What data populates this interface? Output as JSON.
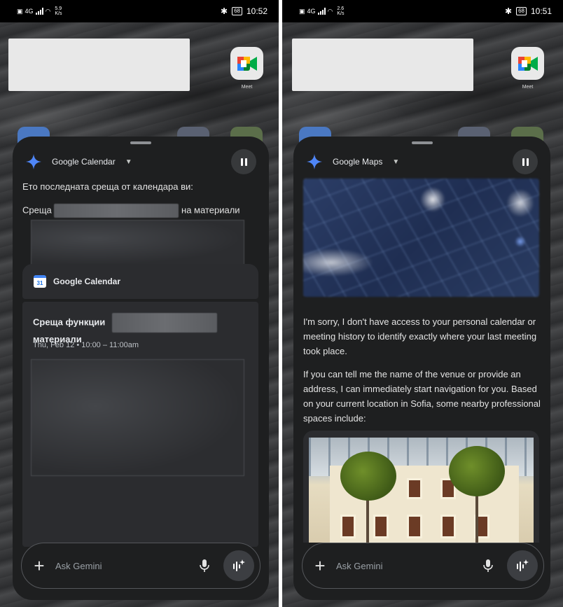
{
  "left_screen": {
    "status": {
      "speed": "5.9",
      "speed_unit": "K/s",
      "battery": "68",
      "time": "10:52",
      "network": "4G"
    },
    "home": {
      "meet_label": "Meet"
    },
    "assistant": {
      "app_name": "Google Calendar",
      "intro": "Ето последната среща от календара ви:",
      "meeting_prefix": "Среща",
      "meeting_suffix": "на материали",
      "card_title": "Google Calendar",
      "calendar_icon_text": "31",
      "event_title_start": "Среща функции",
      "event_title_end": "материали",
      "event_time": "Thu, Feb 12 • 10:00 – 11:00am"
    },
    "input": {
      "placeholder": "Ask Gemini"
    }
  },
  "right_screen": {
    "status": {
      "speed": "2.6",
      "speed_unit": "K/s",
      "battery": "68",
      "time": "10:51",
      "network": "4G"
    },
    "home": {
      "meet_label": "Meet"
    },
    "assistant": {
      "app_name": "Google Maps",
      "response_p1": "I'm sorry, I don't have access to your personal calendar or meeting history to identify exactly where your last meeting took place.",
      "response_p2": "If you can tell me the name of the venue or provide an address, I can immediately start navigation for you. Based on your current location in Sofia, some nearby professional spaces include:"
    },
    "input": {
      "placeholder": "Ask Gemini"
    }
  },
  "colors": {
    "sheet": "#1e1f20",
    "card": "#2b2c2f",
    "accent_blue": "#4285f4"
  }
}
